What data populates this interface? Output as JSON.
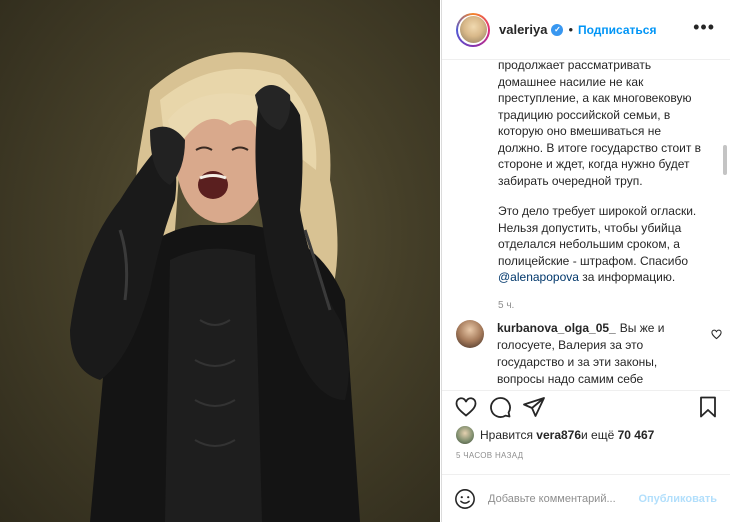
{
  "post": {
    "username": "valeriya",
    "separator": "•",
    "follow_label": "Подписаться",
    "more_label": "•••",
    "icons": {
      "verified": "verified-badge-icon",
      "more": "more-options-icon",
      "like": "heart-icon",
      "comment": "comment-bubble-icon",
      "share": "paper-plane-icon",
      "save": "bookmark-icon",
      "emoji": "smiley-icon"
    }
  },
  "caption": {
    "paragraph1": "продолжает рассматривать\nдомашнее насилие не как\nпреступление, а как многовековую\nтрадицию российской семьи, в\nкоторую оно вмешиваться не\nдолжно. В итоге государство стоит в\nстороне и ждет, когда нужно будет\nзабирать очередной труп.",
    "paragraph2_pre": "Это дело требует широкой огласки.\nНельзя допустить, чтобы убийца\nотделался небольшим сроком, а\nполицейские - штрафом. Спасибо\n",
    "mention": "@alenapopova",
    "paragraph2_post": " за информацию.",
    "time": "5 ч."
  },
  "comment": {
    "username": "kurbanova_olga_05_",
    "text": "Вы же и голосуете, Валерия за это государство и за эти законы, вопросы надо самим себе"
  },
  "likes": {
    "prefix": "Нравится ",
    "user": "vera876",
    "middle": " и ещё ",
    "count": "70 467"
  },
  "post_time": "5 часов назад",
  "add_comment": {
    "placeholder": "Добавьте комментарий...",
    "publish_label": "Опубликовать"
  },
  "colors": {
    "accent": "#0095f6",
    "verified": "#3897f0",
    "publish_disabled": "#b2dffc",
    "mention": "#00376b"
  }
}
